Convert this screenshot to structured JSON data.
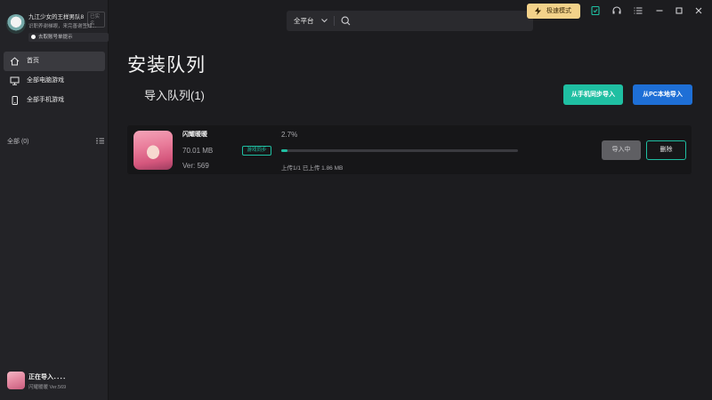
{
  "colors": {
    "accent": "#1fbfa2",
    "primary_blue": "#1e6fd6",
    "speed_gold": "#f3d28a",
    "background": "#1c1c1f",
    "sidebar": "#232327"
  },
  "profile": {
    "name": "九江少女的王样男队8",
    "tag": "已实名",
    "subtitle": "识职养谢梯眼，来完善谢签知...",
    "row_label": "去取账号单提示"
  },
  "sidebar": {
    "items": [
      {
        "label": "首页",
        "icon": "home-icon",
        "active": true
      },
      {
        "label": "全部电脑游戏",
        "icon": "monitor-icon",
        "active": false
      },
      {
        "label": "全部手机游戏",
        "icon": "phone-icon",
        "active": false
      }
    ],
    "category_label": "全部 (0)",
    "category_icon": "list-icon"
  },
  "sidebar_footer": {
    "title": "正在导入．．．．",
    "subtitle": "闪耀暖暖 Ver.569"
  },
  "topbar": {
    "platform_select": "全平台",
    "platform_icon": "chevron-down-icon",
    "search_icon": "search-icon",
    "speed_mode_label": "极速模式",
    "icons": [
      "tasks-icon",
      "headset-icon",
      "menu-icon",
      "minimize-icon",
      "maximize-icon",
      "close-icon"
    ]
  },
  "main": {
    "page_title": "安装队列",
    "queue_title": "导入队列(1)",
    "btn_phone_sync": "从手机同步导入",
    "btn_pc_import": "从PC本地导入"
  },
  "queue": [
    {
      "name": "闪耀暖暖",
      "size": "70.01 MB",
      "version": "Ver: 569",
      "badge": "游戏同步",
      "percent_text": "2.7%",
      "progress": 0.027,
      "upload_text": "上传1/1 已上传 1.86 MB",
      "btn_importing": "导入中",
      "btn_delete": "删除"
    }
  ]
}
